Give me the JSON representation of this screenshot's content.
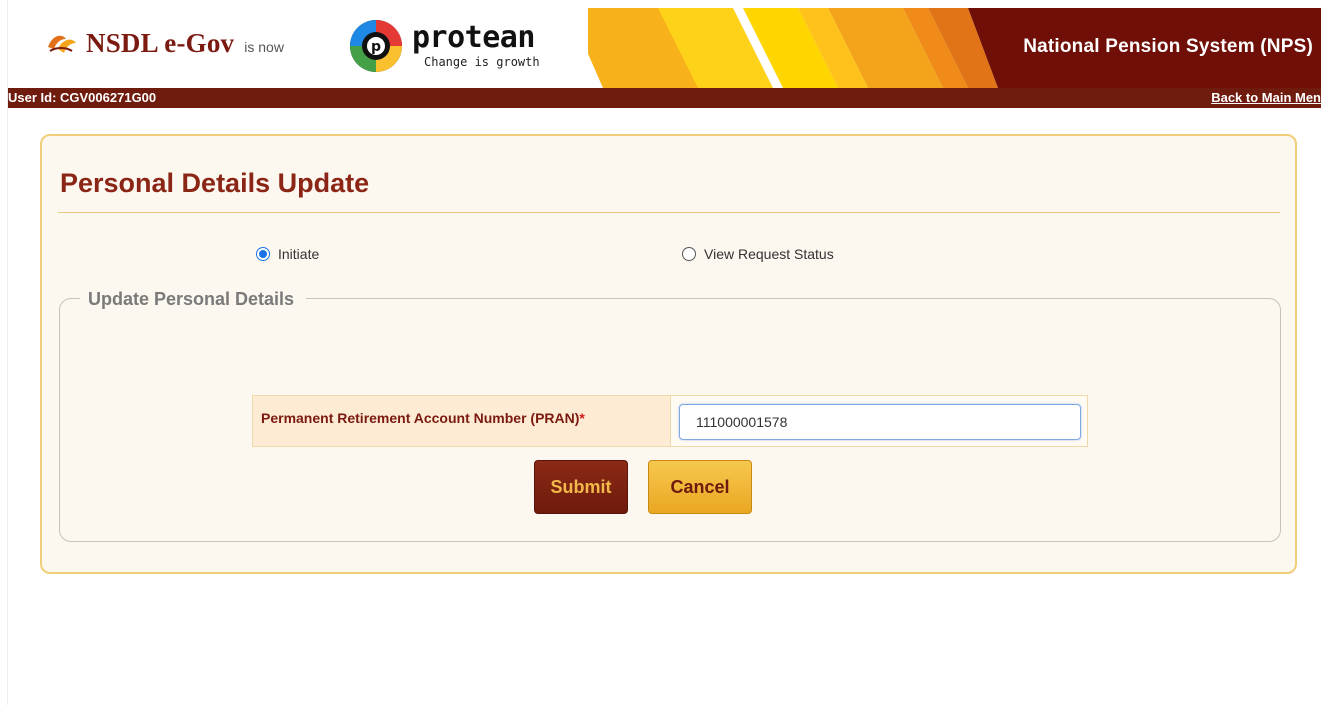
{
  "header": {
    "nsdl_brand": "NSDL e-Gov",
    "is_now": "is now",
    "protean_brand": "protean",
    "protean_tagline": "Change is growth",
    "system_title": "National Pension System (NPS)"
  },
  "userbar": {
    "user_id": "User Id: CGV006271G00",
    "back_link": "Back to Main Men"
  },
  "card": {
    "title": "Personal Details Update",
    "radios": [
      {
        "label": "Initiate",
        "checked": true
      },
      {
        "label": "View Request Status",
        "checked": false
      }
    ],
    "fieldset_legend": "Update Personal Details",
    "pran_label": "Permanent Retirement Account Number (PRAN)",
    "required_mark": "*",
    "pran_value": "111000001578",
    "submit_label": "Submit",
    "cancel_label": "Cancel"
  },
  "colors": {
    "maroon": "#6f1c0e",
    "title_red": "#8b2515",
    "card_border": "#f1cf7a",
    "card_bg": "#fcf7ef",
    "gold": "#f6c84f"
  }
}
